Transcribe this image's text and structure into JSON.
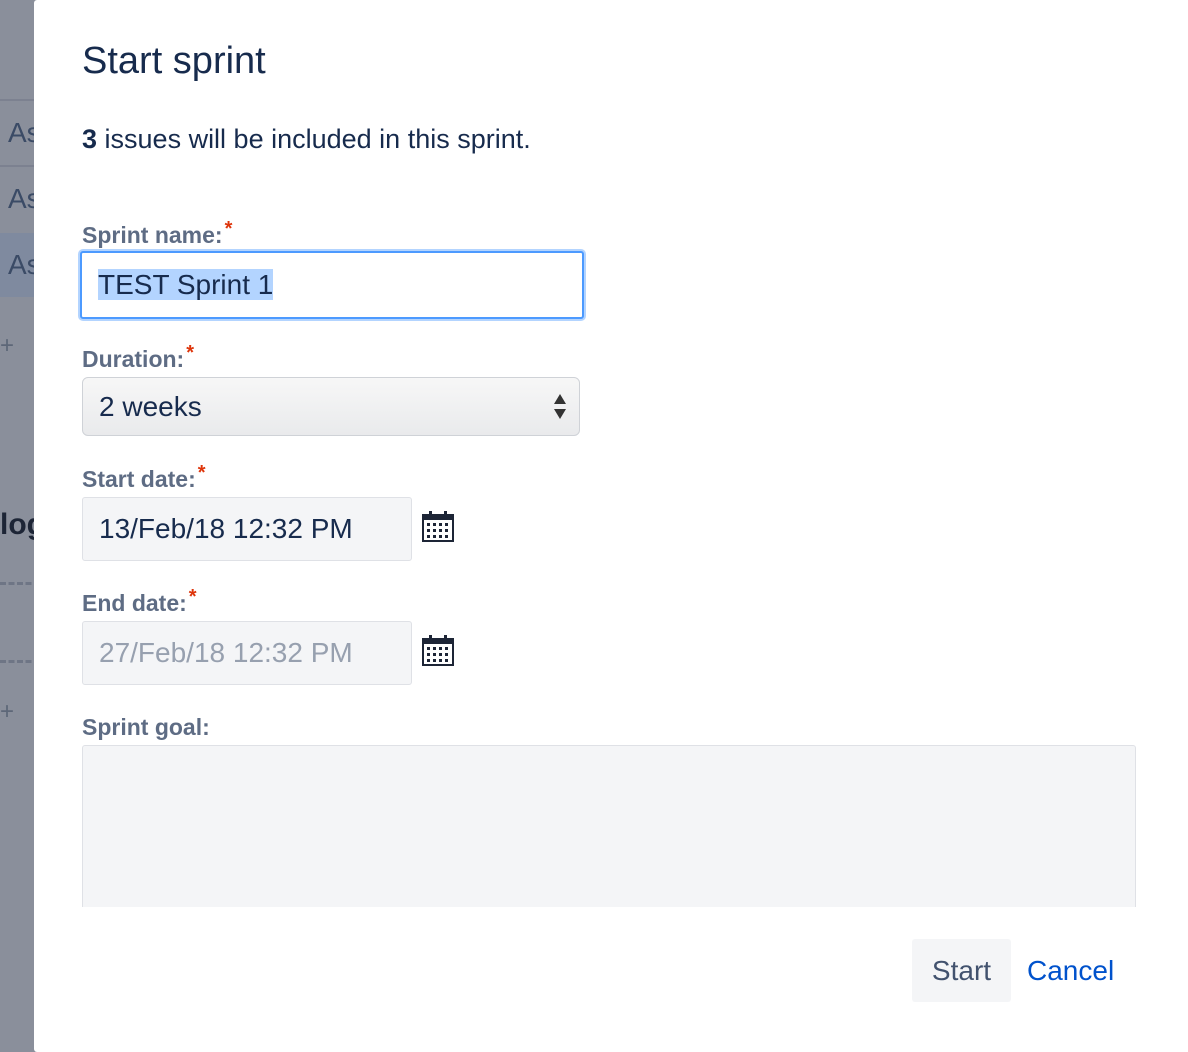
{
  "background": {
    "rows": [
      "As",
      "As",
      "As"
    ],
    "section_title": "log"
  },
  "dialog": {
    "title": "Start sprint",
    "summary_count": "3",
    "summary_text": " issues will be included in this sprint.",
    "required_marker": "*",
    "sprint_name": {
      "label": "Sprint name:",
      "value": "TEST Sprint 1"
    },
    "duration": {
      "label": "Duration:",
      "value": "2 weeks"
    },
    "start_date": {
      "label": "Start date:",
      "value": "13/Feb/18 12:32 PM"
    },
    "end_date": {
      "label": "End date:",
      "value": "27/Feb/18 12:32 PM"
    },
    "sprint_goal": {
      "label": "Sprint goal:",
      "value": ""
    },
    "start_button": "Start",
    "cancel_link": "Cancel"
  },
  "colors": {
    "accent": "#0052cc",
    "focus": "#4c9aff",
    "required": "#de350b",
    "overlay": "#8a8f9b"
  },
  "icons": {
    "calendar": "calendar-icon",
    "select_arrows": "select-arrows-icon"
  }
}
